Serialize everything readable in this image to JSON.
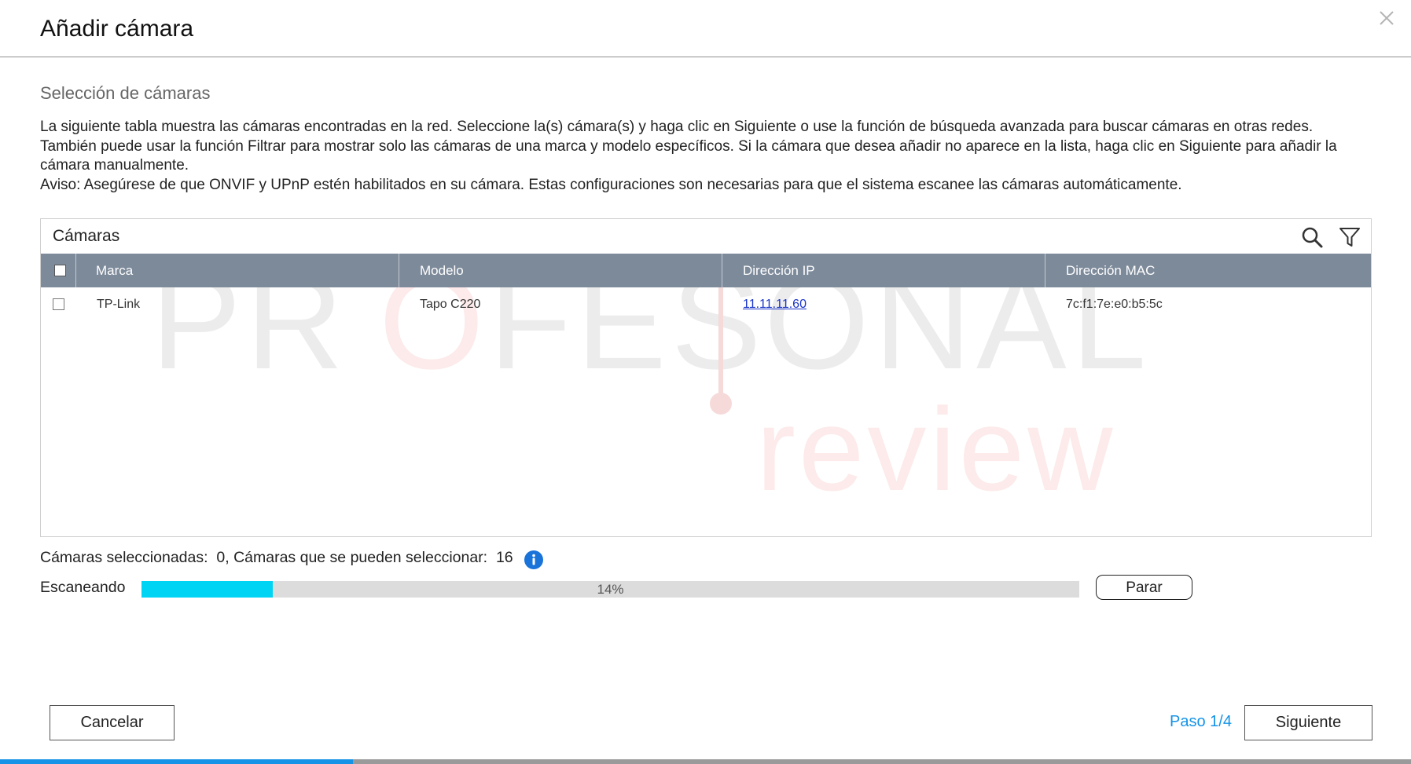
{
  "dialog": {
    "title": "Añadir cámara",
    "close_icon": "close-icon"
  },
  "section": {
    "title": "Selección de cámaras",
    "description": [
      "La siguiente tabla muestra las cámaras encontradas en la red. Seleccione la(s) cámara(s) y haga clic en Siguiente o use la función de búsqueda avanzada para buscar cámaras en otras redes.",
      "También puede usar la función Filtrar para mostrar solo las cámaras de una marca y modelo específicos. Si la cámara que desea añadir no aparece en la lista, haga clic en Siguiente para añadir la cámara manualmente.",
      "Aviso: Asegúrese de que ONVIF y UPnP estén habilitados en su cámara. Estas configuraciones son necesarias para que el sistema escanee las cámaras automáticamente."
    ]
  },
  "table": {
    "title": "Cámaras",
    "tools": [
      "search-icon",
      "filter-icon"
    ],
    "columns": [
      "Marca",
      "Modelo",
      "Dirección IP",
      "Dirección MAC"
    ],
    "rows": [
      {
        "checked": false,
        "marca": "TP-Link",
        "modelo": "Tapo C220",
        "ip": "11.11.11.60",
        "mac": "7c:f1:7e:e0:b5:5c"
      }
    ]
  },
  "status": {
    "selected_label": "Cámaras seleccionadas:",
    "selected_value": "0",
    "selectable_label": "Cámaras que se pueden seleccionar:",
    "selectable_value": "16",
    "info_icon": "info-icon"
  },
  "scan": {
    "label": "Escaneando",
    "progress": 0.14,
    "progress_text": "14%",
    "stop_label": "Parar",
    "bar_color": "#00d4f4"
  },
  "footer": {
    "cancel_label": "Cancelar",
    "step_text": "Paso 1/4",
    "next_label": "Siguiente",
    "wizard_progress": 0.25,
    "accent_color": "#1693e6"
  },
  "watermark": {
    "word1": "PROFESIONAL",
    "word2": "review"
  }
}
